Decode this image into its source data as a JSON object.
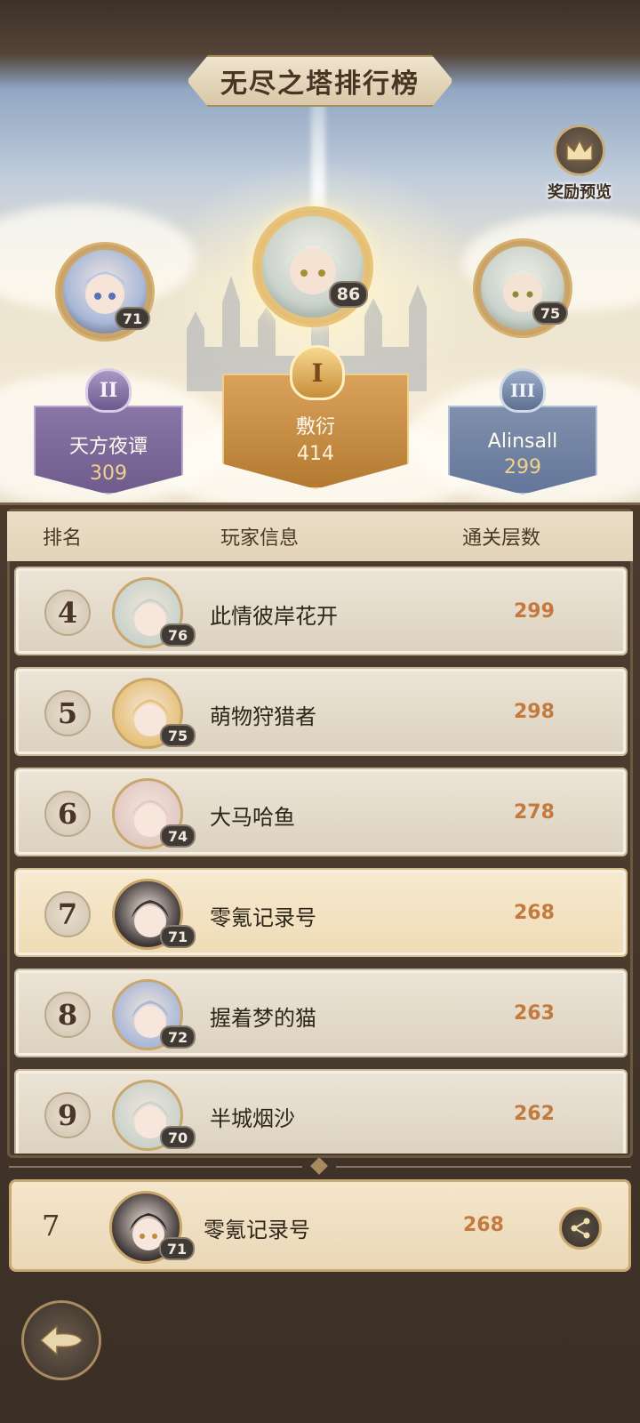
{
  "title": "无尽之塔排行榜",
  "reward_preview": {
    "label": "奖励预览",
    "icon": "crown-icon"
  },
  "podium": [
    {
      "rank": "I",
      "name": "敷衍",
      "score": "414",
      "level": "86",
      "color": "#c8903e"
    },
    {
      "rank": "II",
      "name": "天方夜谭",
      "score": "309",
      "level": "71",
      "color": "#7b6a9a"
    },
    {
      "rank": "III",
      "name": "Alinsall",
      "score": "299",
      "level": "75",
      "color": "#6c7e9c"
    }
  ],
  "table": {
    "headers": {
      "rank": "排名",
      "player": "玩家信息",
      "floors": "通关层数"
    },
    "rows": [
      {
        "rank": "4",
        "name": "此情彼岸花开",
        "level": "76",
        "score": "299"
      },
      {
        "rank": "5",
        "name": "萌物狩猎者",
        "level": "75",
        "score": "298"
      },
      {
        "rank": "6",
        "name": "大马哈鱼",
        "level": "74",
        "score": "278"
      },
      {
        "rank": "7",
        "name": "零氪记录号",
        "level": "71",
        "score": "268"
      },
      {
        "rank": "8",
        "name": "握着梦的猫",
        "level": "72",
        "score": "263"
      },
      {
        "rank": "9",
        "name": "半城烟沙",
        "level": "70",
        "score": "262"
      }
    ]
  },
  "my_rank": {
    "rank": "7",
    "name": "零氪记录号",
    "level": "71",
    "score": "268",
    "share_icon": "share-icon"
  },
  "back": {
    "icon": "back-arrow-icon"
  }
}
